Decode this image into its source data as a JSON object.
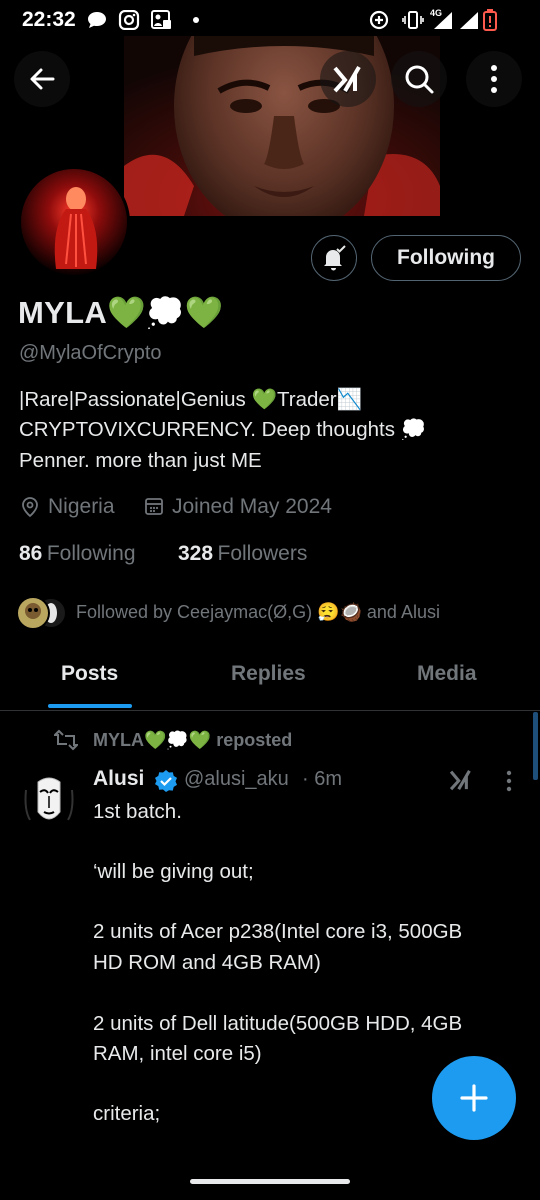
{
  "status_bar": {
    "time": "22:32",
    "network": "4G",
    "icons": [
      "chat-bubble-icon",
      "instagram-icon",
      "gallery-icon",
      "dot-icon",
      "data-saver-icon",
      "vibrate-icon",
      "signal-icon",
      "battery-low-icon"
    ]
  },
  "colors": {
    "accent": "#1d9bf0",
    "background": "#000000",
    "muted": "#71767b",
    "divider": "#2f3336"
  },
  "top_bar": {
    "icons": [
      "back-arrow-icon",
      "grok-icon",
      "search-icon",
      "more-vertical-icon"
    ]
  },
  "profile": {
    "display_name": "MYLA💚💭💚",
    "handle": "@MylaOfCrypto",
    "bio_lines": [
      "|Rare|Passionate|Genius 💚Trader📉",
      "CRYPTOVIXCURRENCY. Deep thoughts 💭",
      "Penner. more than just ME"
    ],
    "location": "Nigeria",
    "joined": "Joined May 2024",
    "following_count": "86",
    "following_label": "Following",
    "followers_count": "328",
    "followers_label": "Followers",
    "followed_by": "Followed by Ceejaymac(Ø,G) 😮‍💨🥥 and Alusi",
    "follow_button": "Following"
  },
  "tabs": [
    {
      "label": "Posts",
      "active": true
    },
    {
      "label": "Replies",
      "active": false
    },
    {
      "label": "Media",
      "active": false
    }
  ],
  "tweet": {
    "repost_label": "MYLA💚💭💚 reposted",
    "author_name": "Alusi",
    "author_handle": "@alusi_aku",
    "time": "· 6m",
    "lines": [
      "1st batch.",
      "‘will be giving out;",
      "2 units of Acer p238(Intel core i3, 500GB",
      "HD ROM and 4GB RAM)",
      "2 units of Dell latitude(500GB HDD, 4GB",
      "RAM, intel core i5)",
      "criteria;"
    ]
  }
}
